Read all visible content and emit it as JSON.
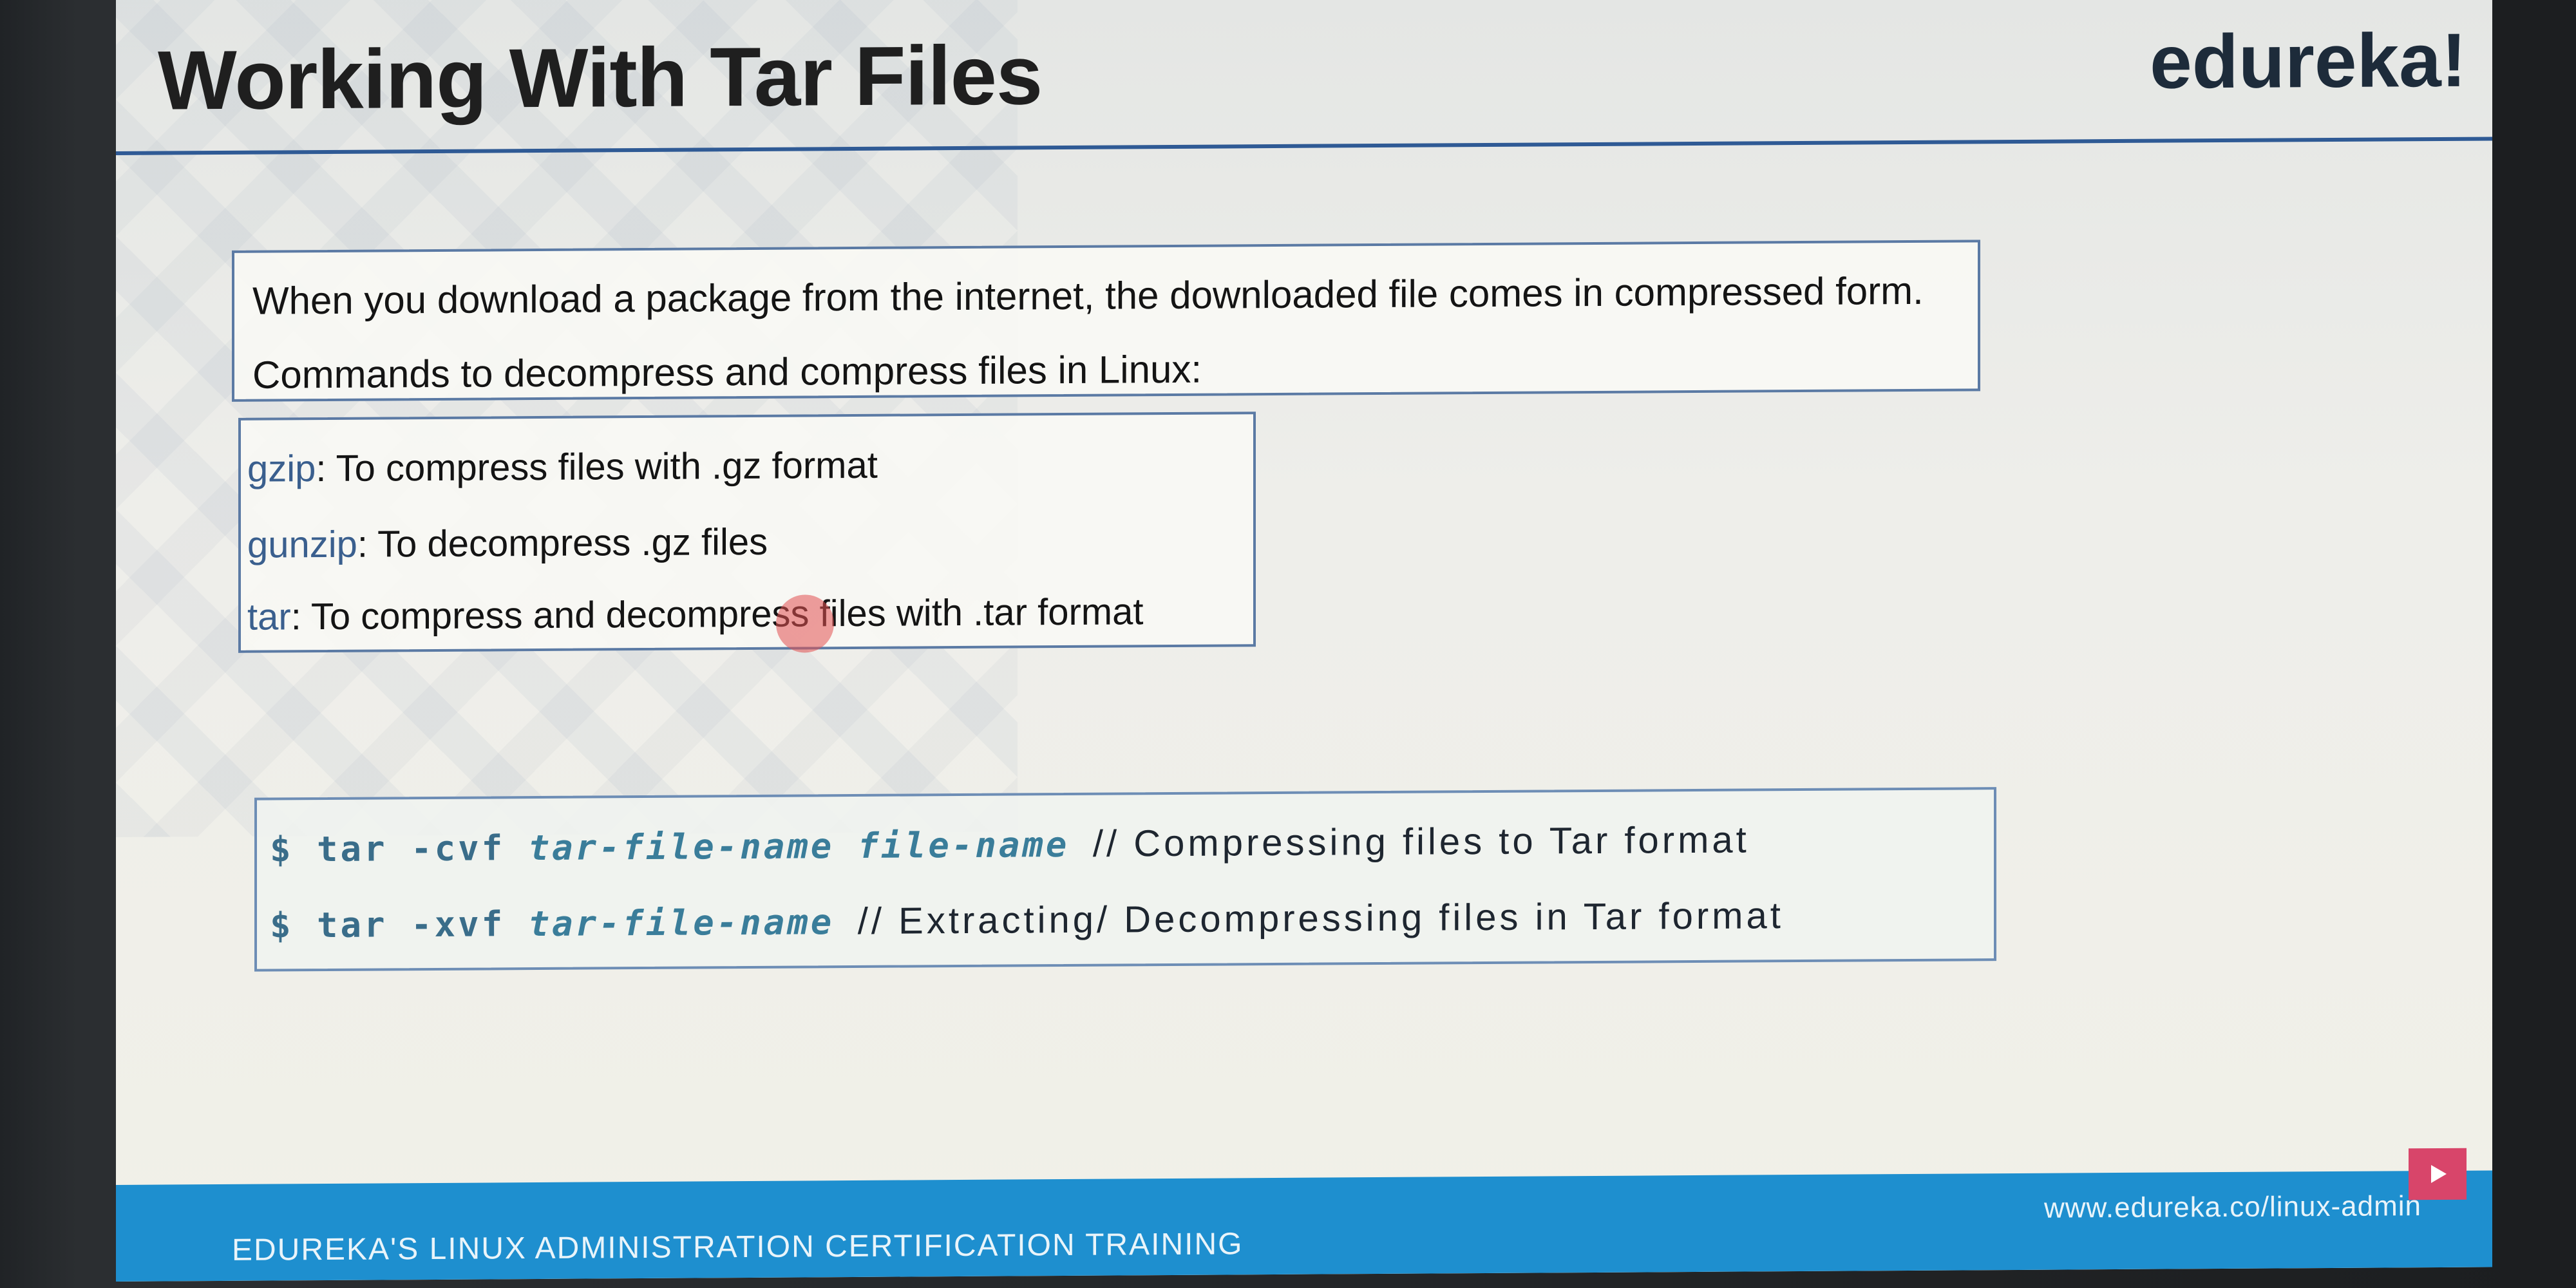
{
  "slide": {
    "title": "Working With Tar Files",
    "brand": "edureka!"
  },
  "intro": {
    "line1": "When you download a package from the internet, the downloaded file comes in compressed form.",
    "line2": "Commands to decompress and compress files in Linux:"
  },
  "commands": [
    {
      "name": "gzip",
      "desc": ": To compress files with .gz format"
    },
    {
      "name": "gunzip",
      "desc": ": To decompress .gz files"
    },
    {
      "name": "tar",
      "desc": ": To compress and decompress files with .tar format"
    }
  ],
  "code": [
    {
      "prompt": "$",
      "cmd": "tar -cvf",
      "args": "tar-file-name file-name",
      "comment": "// Compressing files to Tar format"
    },
    {
      "prompt": "$",
      "cmd": "tar -xvf",
      "args": "tar-file-name",
      "comment": "// Extracting/ Decompressing files in Tar format"
    }
  ],
  "footer": {
    "course": "EDUREKA'S LINUX ADMINISTRATION CERTIFICATION TRAINING",
    "url": "www.edureka.co/linux-admin"
  },
  "icons": {
    "play": "play-icon"
  },
  "colors": {
    "title_rule": "#2f5a95",
    "footer_bar": "#1e8fcf",
    "code_accent": "#3a6d8a",
    "box_border": "#5b7aa4"
  }
}
